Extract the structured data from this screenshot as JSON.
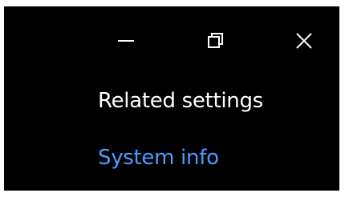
{
  "window": {
    "controls": [
      {
        "name": "minimize",
        "icon": "minimize-icon"
      },
      {
        "name": "maximize",
        "icon": "restore-icon"
      },
      {
        "name": "close",
        "icon": "close-icon"
      }
    ]
  },
  "related": {
    "heading": "Related settings",
    "links": [
      {
        "label": "System info"
      }
    ]
  },
  "colors": {
    "background": "#000000",
    "text": "#ffffff",
    "link": "#4a9dff",
    "icon": "#ffffff"
  }
}
